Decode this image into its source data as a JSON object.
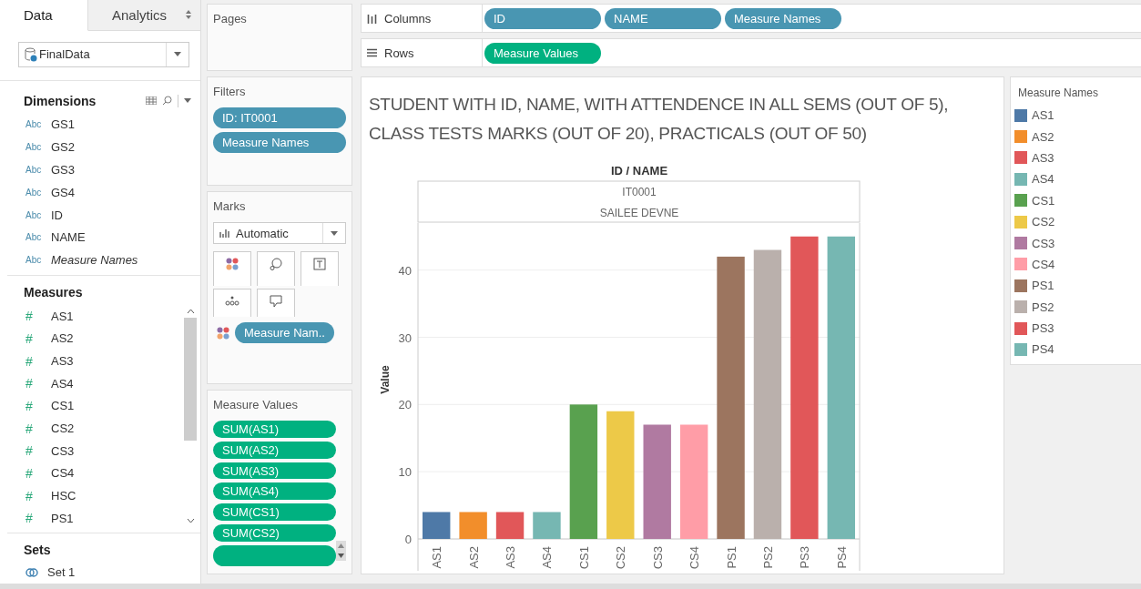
{
  "side_tabs": [
    {
      "label": "Data",
      "selected": true
    },
    {
      "label": "Analytics",
      "selected": false
    }
  ],
  "datasource": {
    "value": "FinalData"
  },
  "dimensions": {
    "title": "Dimensions",
    "items": [
      {
        "type": "Abc",
        "name": "GS1",
        "italic": false
      },
      {
        "type": "Abc",
        "name": "GS2",
        "italic": false
      },
      {
        "type": "Abc",
        "name": "GS3",
        "italic": false
      },
      {
        "type": "Abc",
        "name": "GS4",
        "italic": false
      },
      {
        "type": "Abc",
        "name": "ID",
        "italic": false
      },
      {
        "type": "Abc",
        "name": "NAME",
        "italic": false
      },
      {
        "type": "Abc",
        "name": "Measure Names",
        "italic": true
      }
    ]
  },
  "measures": {
    "title": "Measures",
    "items": [
      {
        "type": "#",
        "name": "AS1"
      },
      {
        "type": "#",
        "name": "AS2"
      },
      {
        "type": "#",
        "name": "AS3"
      },
      {
        "type": "#",
        "name": "AS4"
      },
      {
        "type": "#",
        "name": "CS1"
      },
      {
        "type": "#",
        "name": "CS2"
      },
      {
        "type": "#",
        "name": "CS3"
      },
      {
        "type": "#",
        "name": "CS4"
      },
      {
        "type": "#",
        "name": "HSC"
      },
      {
        "type": "#",
        "name": "PS1"
      }
    ]
  },
  "sets": {
    "title": "Sets",
    "items": [
      "Set 1"
    ]
  },
  "pages": {
    "title": "Pages"
  },
  "filters": {
    "title": "Filters",
    "pills": [
      "ID: IT0001",
      "Measure Names"
    ]
  },
  "marks": {
    "title": "Marks",
    "type": "Automatic",
    "color_pill": "Measure Nam.."
  },
  "measure_values": {
    "title": "Measure Values",
    "pills": [
      "SUM(AS1)",
      "SUM(AS2)",
      "SUM(AS3)",
      "SUM(AS4)",
      "SUM(CS1)",
      "SUM(CS2)"
    ]
  },
  "columns_shelf": {
    "label": "Columns",
    "pills": [
      "ID",
      "NAME",
      "Measure Names"
    ]
  },
  "rows_shelf": {
    "label": "Rows",
    "pills": [
      "Measure Values"
    ]
  },
  "view": {
    "title": "STUDENT WITH ID, NAME, WITH ATTENDENCE IN ALL SEMS (OUT OF 5), CLASS TESTS MARKS (OUT OF 20), PRACTICALS (OUT OF 50)",
    "header_title": "ID / NAME",
    "header_id": "IT0001",
    "header_name": "SAILEE DEVNE",
    "chart_data": {
      "type": "bar",
      "ylabel": "Value",
      "categories": [
        "AS1",
        "AS2",
        "AS3",
        "AS4",
        "CS1",
        "CS2",
        "CS3",
        "CS4",
        "PS1",
        "PS2",
        "PS3",
        "PS4"
      ],
      "values": [
        4,
        4,
        4,
        4,
        20,
        19,
        17,
        17,
        42,
        43,
        45,
        45
      ],
      "ylim": [
        0,
        47
      ],
      "yticks": [
        0,
        10,
        20,
        30,
        40
      ],
      "grid": true
    }
  },
  "legend": {
    "title": "Measure Names",
    "items": [
      {
        "label": "AS1",
        "color": "#4e79a7"
      },
      {
        "label": "AS2",
        "color": "#f28e2b"
      },
      {
        "label": "AS3",
        "color": "#e15759"
      },
      {
        "label": "AS4",
        "color": "#76b7b2"
      },
      {
        "label": "CS1",
        "color": "#59a14f"
      },
      {
        "label": "CS2",
        "color": "#edc948"
      },
      {
        "label": "CS3",
        "color": "#b07aa1"
      },
      {
        "label": "CS4",
        "color": "#ff9da7"
      },
      {
        "label": "PS1",
        "color": "#9c755f"
      },
      {
        "label": "PS2",
        "color": "#bab0ac"
      },
      {
        "label": "PS3",
        "color": "#e15759"
      },
      {
        "label": "PS4",
        "color": "#76b7b2"
      }
    ]
  }
}
